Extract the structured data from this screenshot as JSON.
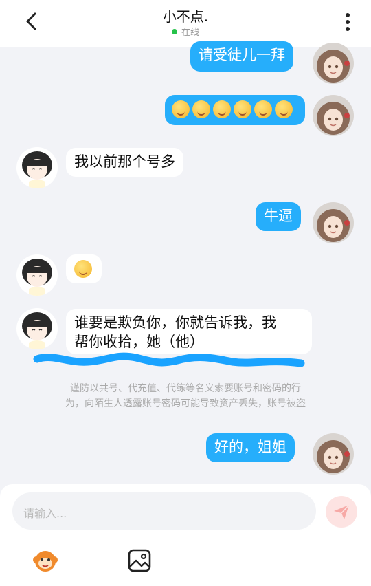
{
  "header": {
    "title": "小不点.",
    "status": "在线"
  },
  "messages": [
    {
      "side": "right",
      "text": "请受徒儿一拜"
    },
    {
      "side": "right",
      "emoji": [
        "smile",
        "smile",
        "smile",
        "grin",
        "grin",
        "grin"
      ]
    },
    {
      "side": "left",
      "text": "我以前那个号多"
    },
    {
      "side": "right",
      "text": "牛逼"
    },
    {
      "side": "left",
      "emoji": [
        "smile"
      ]
    },
    {
      "side": "left",
      "lines": [
        "谁要是欺负你，你就告诉我，我",
        "帮你收拾，她（他）"
      ]
    },
    {
      "side": "right",
      "text": "好的，姐姐"
    }
  ],
  "notice": {
    "line1": "谨防以共号、代充值、代练等名义索要账号和密码的行",
    "line2": "为，向陌生人透露账号密码可能导致资产丢失，账号被盗"
  },
  "input": {
    "placeholder": "请输入..."
  },
  "colors": {
    "accent": "#26aefb",
    "online": "#26c24a",
    "send_bg": "#fde3e2",
    "scribble": "#1aa3ff"
  }
}
